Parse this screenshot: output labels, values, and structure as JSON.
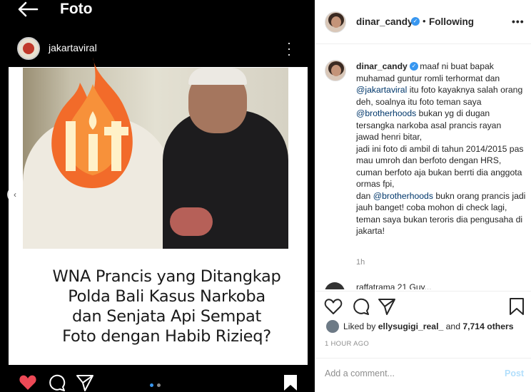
{
  "colors": {
    "accent": "#3897f0",
    "like_red": "#ed4956",
    "post_disabled": "#b2dffc"
  },
  "left": {
    "topbar": {
      "title": "Foto",
      "back_icon": "arrow-left-icon"
    },
    "inner_post": {
      "username": "jakartaviral",
      "more_icon": "more-vertical-icon",
      "sticker_icon": "lit-fire-icon",
      "headline_lines": [
        "WNA Prancis yang Ditangkap",
        "Polda Bali Kasus Narkoba",
        "dan Senjata Api Sempat",
        "Foto dengan Habib Rizieq?"
      ],
      "carousel_prev_icon": "chevron-left-icon"
    }
  },
  "right": {
    "header": {
      "username": "dinar_candy",
      "separator": "•",
      "follow_status": "Following",
      "more": "•••"
    },
    "caption": {
      "username": "dinar_candy",
      "seg1": " maaf ni buat bapak muhamad guntur romli terhormat dan ",
      "mention1": "@jakartaviral",
      "seg2": " itu foto kayaknya salah orang deh, soalnya itu foto teman saya ",
      "mention2": "@brotherhoods",
      "seg3": " bukan yg di dugan tersangka narkoba asal prancis rayan jawad henri bitar,",
      "line_a": "jadi ini foto di ambil di tahun 2014/2015 pas mau umroh dan berfoto dengan HRS, cuman berfoto aja bukan berrti dia anggota ormas fpi,",
      "seg4": "dan ",
      "mention3": "@brotherhoods",
      "seg5": " bukn orang prancis jadi jauh banget! coba mohon di check lagi, teman saya bukan teroris dia pengusaha di jakarta!",
      "time": "1h"
    },
    "partial_comment": "raffatrama 21 Guy..."
  },
  "likes": {
    "prefix": "Liked by ",
    "user": "ellysugigi_real_",
    "mid": " and ",
    "count": "7,714 others"
  },
  "date": "1 HOUR AGO",
  "comment_box": {
    "placeholder": "Add a comment...",
    "post_label": "Post"
  }
}
